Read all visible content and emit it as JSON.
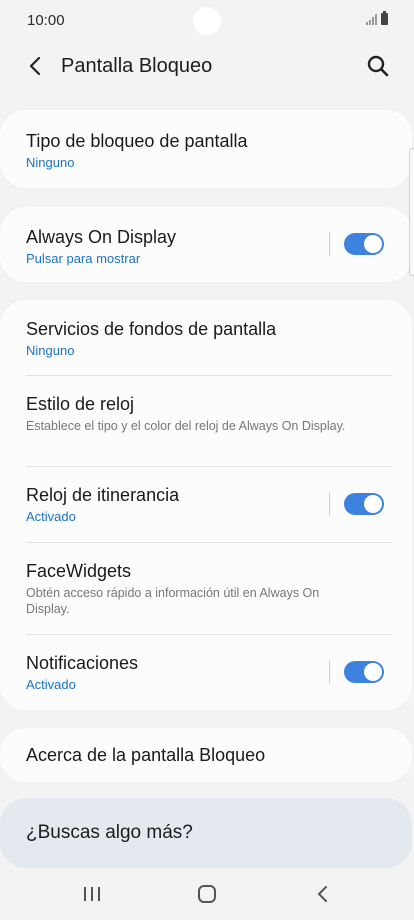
{
  "status_bar": {
    "time": "10:00"
  },
  "header": {
    "title": "Pantalla Bloqueo"
  },
  "lock_type": {
    "title": "Tipo de bloqueo de pantalla",
    "value": "Ninguno"
  },
  "always_on": {
    "title": "Always On Display",
    "value": "Pulsar para mostrar",
    "enabled": true
  },
  "settings": {
    "wallpaper_services": {
      "title": "Servicios de fondos de pantalla",
      "value": "Ninguno"
    },
    "clock_style": {
      "title": "Estilo de reloj",
      "description": "Establece el tipo y el color del reloj de Always On Display."
    },
    "roaming_clock": {
      "title": "Reloj de itinerancia",
      "value": "Activado",
      "enabled": true
    },
    "facewidgets": {
      "title": "FaceWidgets",
      "description": "Obtén acceso rápido a información útil en Always On Display."
    },
    "notifications": {
      "title": "Notificaciones",
      "value": "Activado",
      "enabled": true
    }
  },
  "about": {
    "title": "Acerca de la pantalla Bloqueo"
  },
  "looking_for": {
    "title": "¿Buscas algo más?"
  },
  "colors": {
    "accent": "#3e82e0",
    "link": "#1a73c8",
    "background": "#f3f3f3",
    "card": "#fcfcfc"
  }
}
